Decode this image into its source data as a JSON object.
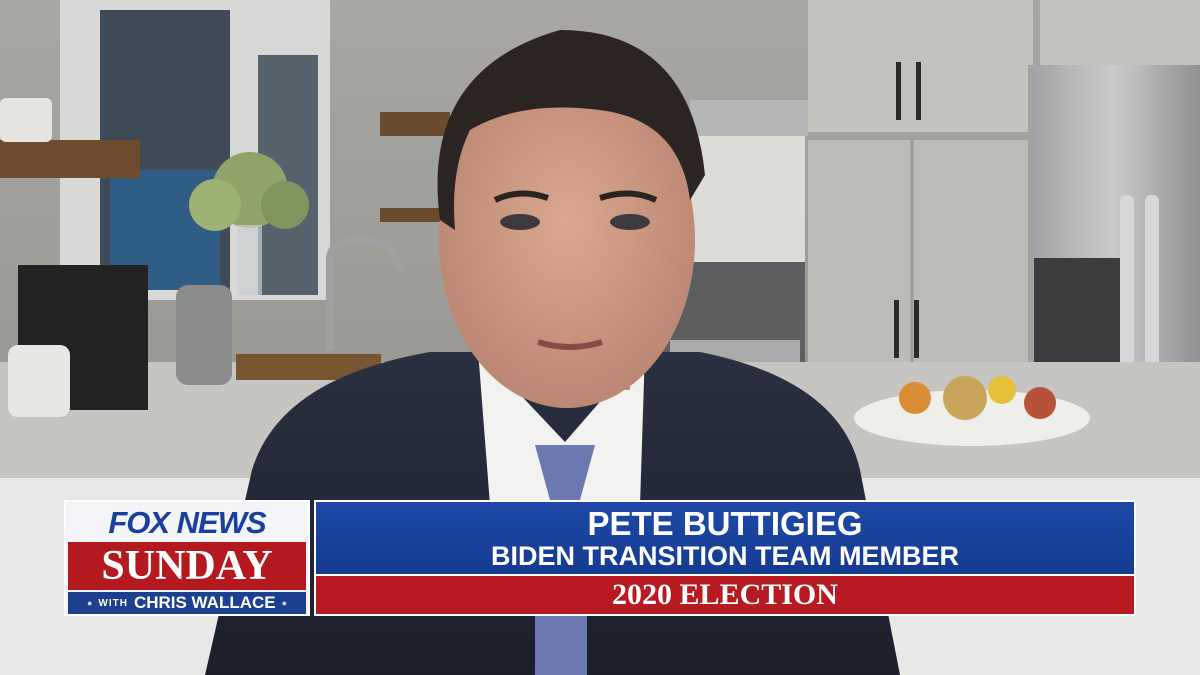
{
  "lower_third": {
    "network": "FOX NEWS",
    "show": "SUNDAY",
    "with_label": "WITH",
    "host": "CHRIS WALLACE",
    "guest_name": "PETE BUTTIGIEG",
    "guest_title": "BIDEN TRANSITION TEAM MEMBER",
    "topic": "2020 ELECTION"
  },
  "colors": {
    "fox_blue": "#1b3f9c",
    "sunday_red": "#b3191f",
    "name_bar_blue": "#1a43a0",
    "topic_red": "#b71a21"
  },
  "icons": [
    "fox-news-logo",
    "dot-separator-icon"
  ]
}
